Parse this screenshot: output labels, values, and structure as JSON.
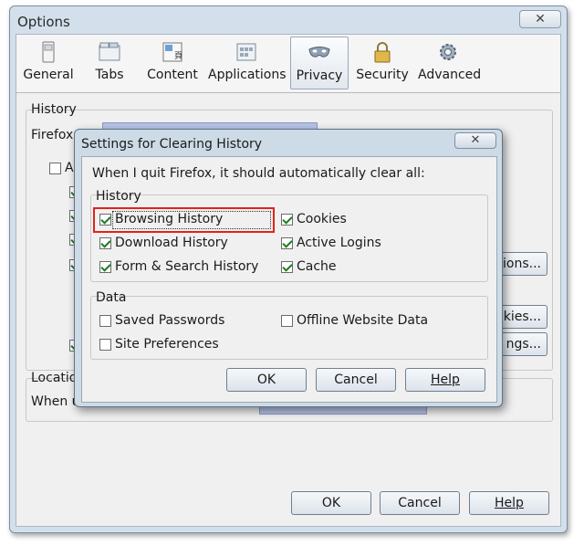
{
  "options_window": {
    "title": "Options",
    "close_glyph": "✕",
    "toolbar": [
      {
        "label": "General",
        "icon": "general-icon"
      },
      {
        "label": "Tabs",
        "icon": "tabs-icon"
      },
      {
        "label": "Content",
        "icon": "content-icon"
      },
      {
        "label": "Applications",
        "icon": "applications-icon"
      },
      {
        "label": "Privacy",
        "icon": "privacy-mask-icon",
        "selected": true
      },
      {
        "label": "Security",
        "icon": "lock-icon"
      },
      {
        "label": "Advanced",
        "icon": "gear-icon"
      }
    ],
    "history_group": {
      "title": "History",
      "firefox_will_prefix": "Firefox",
      "clear_prefix": "A",
      "exceptions_suffix": "tions...",
      "cookies_suffix": "okies...",
      "settings_suffix": "ngs..."
    },
    "location_group": {
      "title": "Locatio",
      "when_prefix": "When u"
    },
    "buttons": {
      "ok": "OK",
      "cancel": "Cancel",
      "help": "Help"
    }
  },
  "dialog": {
    "title": "Settings for Clearing History",
    "close_glyph": "✕",
    "intro": "When I quit Firefox, it should automatically clear all:",
    "history_section": {
      "title": "History",
      "items": [
        {
          "label": "Browsing History",
          "checked": true
        },
        {
          "label": "Download History",
          "checked": true
        },
        {
          "label": "Form & Search History",
          "checked": true
        },
        {
          "label": "Cookies",
          "checked": true
        },
        {
          "label": "Active Logins",
          "checked": true
        },
        {
          "label": "Cache",
          "checked": true
        }
      ]
    },
    "data_section": {
      "title": "Data",
      "items": [
        {
          "label": "Saved Passwords",
          "checked": false
        },
        {
          "label": "Site Preferences",
          "checked": false
        },
        {
          "label": "Offline Website Data",
          "checked": false
        }
      ]
    },
    "buttons": {
      "ok": "OK",
      "cancel": "Cancel",
      "help": "Help"
    }
  }
}
